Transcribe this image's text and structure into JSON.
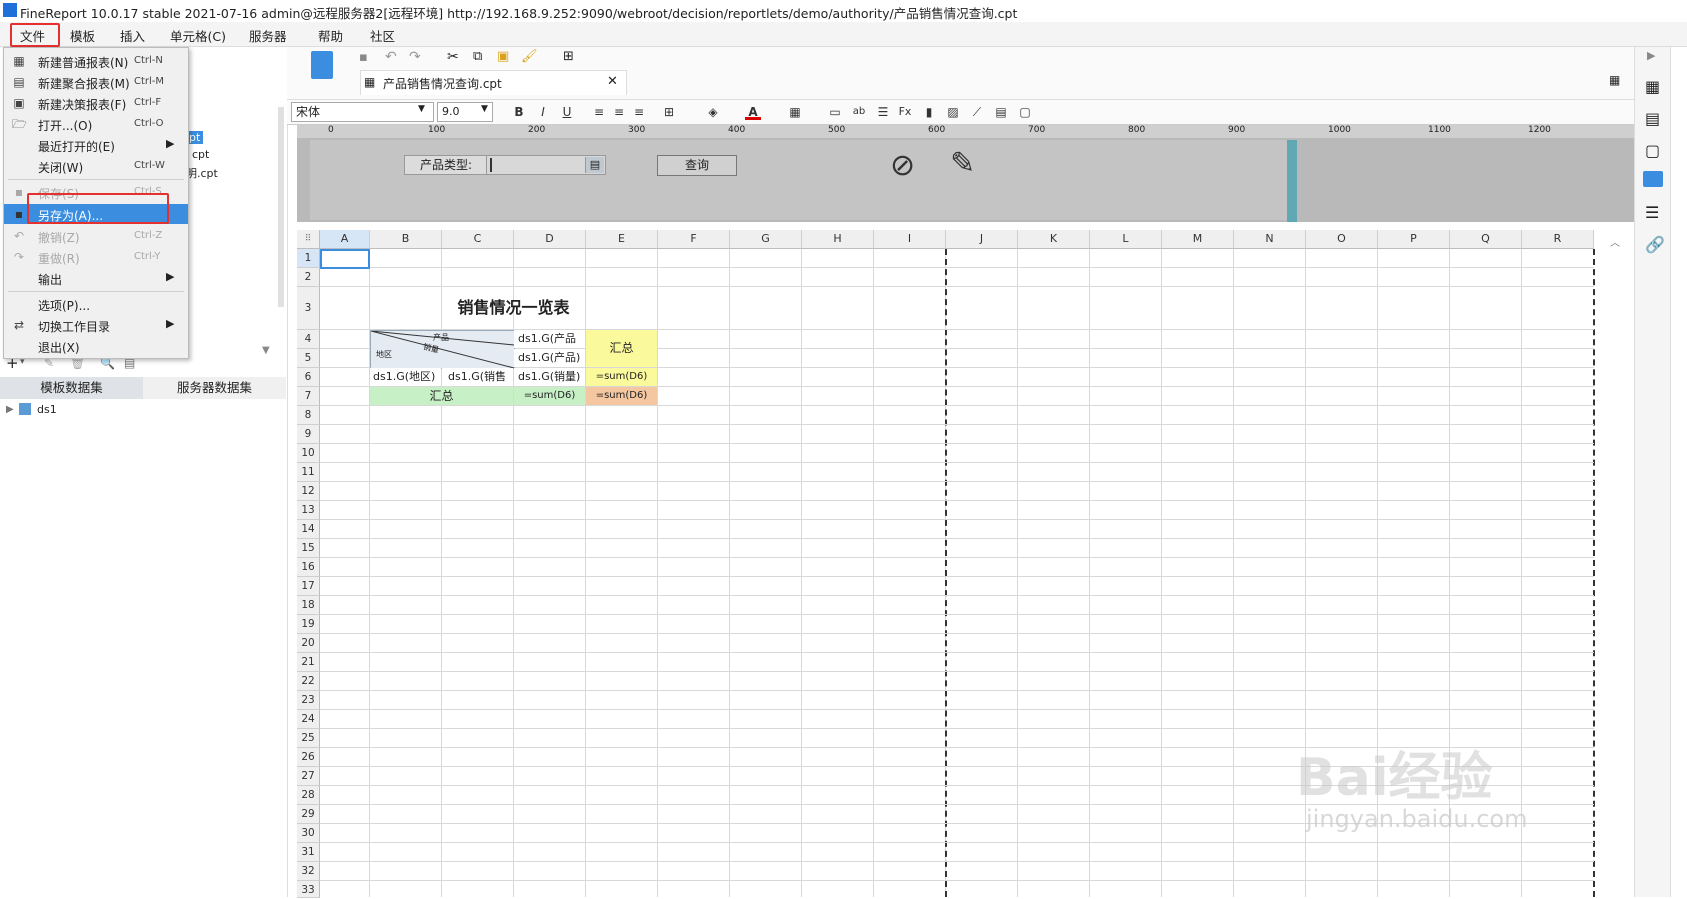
{
  "window": {
    "title": "FineReport 10.0.17 stable 2021-07-16 admin@远程服务器2[远程环境]    http://192.168.9.252:9090/webroot/decision/reportlets/demo/authority/产品销售情况查询.cpt"
  },
  "menubar": {
    "items": [
      "文件",
      "模板",
      "插入",
      "单元格(C)",
      "服务器",
      "帮助",
      "社区"
    ]
  },
  "file_menu": {
    "items": [
      {
        "label": "新建普通报表(N)",
        "shortcut": "Ctrl-N",
        "icon": "grid-report-icon"
      },
      {
        "label": "新建聚合报表(M)",
        "shortcut": "Ctrl-M",
        "icon": "aggregate-report-icon"
      },
      {
        "label": "新建决策报表(F)",
        "shortcut": "Ctrl-F",
        "icon": "decision-report-icon"
      },
      {
        "label": "打开...(O)",
        "shortcut": "Ctrl-O",
        "icon": "folder-open-icon"
      },
      {
        "label": "最近打开的(E)",
        "shortcut": "",
        "icon": ""
      },
      {
        "label": "关闭(W)",
        "shortcut": "Ctrl-W",
        "icon": ""
      },
      {
        "label": "保存(S)",
        "shortcut": "Ctrl-S",
        "icon": "save-icon"
      },
      {
        "label": "另存为(A)...",
        "shortcut": "",
        "icon": "save-as-icon"
      },
      {
        "label": "撤销(Z)",
        "shortcut": "Ctrl-Z",
        "icon": "undo-icon"
      },
      {
        "label": "重做(R)",
        "shortcut": "Ctrl-Y",
        "icon": "redo-icon"
      },
      {
        "label": "输出",
        "shortcut": "",
        "icon": ""
      },
      {
        "label": "选项(P)...",
        "shortcut": "",
        "icon": ""
      },
      {
        "label": "切换工作目录",
        "shortcut": "",
        "icon": "switch-dir-icon"
      },
      {
        "label": "退出(X)",
        "shortcut": "",
        "icon": ""
      }
    ]
  },
  "left_panel": {
    "tree_fragments": [
      "pt",
      "cpt",
      "明.cpt"
    ],
    "dataset_tabs": [
      "模板数据集",
      "服务器数据集"
    ],
    "datasets": [
      "ds1"
    ]
  },
  "editor": {
    "doc_tab": "产品销售情况查询.cpt",
    "font_name": "宋体",
    "font_size": "9.0",
    "ruler_marks": [
      "0",
      "100",
      "200",
      "300",
      "400",
      "500",
      "600",
      "700",
      "800",
      "900",
      "1000",
      "1100",
      "1200"
    ],
    "param": {
      "label": "产品类型:",
      "button": "查询"
    }
  },
  "sheet": {
    "columns": [
      "A",
      "B",
      "C",
      "D",
      "E",
      "F",
      "G",
      "H",
      "I",
      "J",
      "K",
      "L",
      "M",
      "N",
      "O",
      "P",
      "Q",
      "R"
    ],
    "rows": [
      "1",
      "2",
      "3",
      "4",
      "5",
      "6",
      "7",
      "8",
      "9",
      "10",
      "11",
      "12",
      "13",
      "14",
      "15",
      "16",
      "17",
      "18",
      "19",
      "20",
      "21",
      "22",
      "23",
      "24",
      "25",
      "26",
      "27",
      "28",
      "29",
      "30",
      "31",
      "32",
      "33"
    ],
    "cells": {
      "title": "销售情况一览表",
      "slash_product": "产品",
      "slash_sales": "销量",
      "slash_region": "地区",
      "d4": "ds1.G(产品",
      "d5": "ds1.G(产品)",
      "e45": "汇总",
      "b6": "ds1.G(地区)",
      "c6": "ds1.G(销售",
      "d6": "ds1.G(销量)",
      "e6": "=sum(D6)",
      "b7": "汇总",
      "d7": "=sum(D6)",
      "e7": "=sum(D6)"
    }
  },
  "watermark": {
    "brand": "Bai经验",
    "url": "jingyan.baidu.com"
  }
}
